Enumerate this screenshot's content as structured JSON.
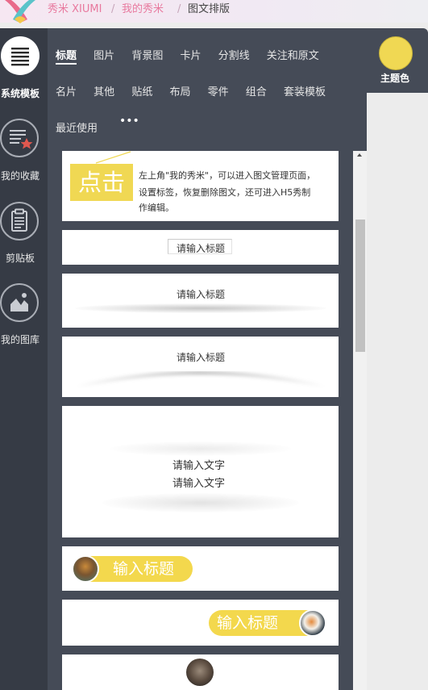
{
  "header": {
    "brand": "秀米 XIUMI",
    "crumb_my_xiumi": "我的秀米",
    "crumb_current": "图文排版",
    "separator": "/"
  },
  "sidebar": {
    "items": [
      {
        "label": "系统模板",
        "icon": "list-icon",
        "active": true
      },
      {
        "label": "我的收藏",
        "icon": "favorites-icon"
      },
      {
        "label": "剪贴板",
        "icon": "clipboard-icon"
      },
      {
        "label": "我的图库",
        "icon": "gallery-icon"
      }
    ]
  },
  "tabs": {
    "row1": [
      "标题",
      "图片",
      "背景图",
      "卡片",
      "分割线",
      "关注和原文"
    ],
    "row2": [
      "名片",
      "其他",
      "贴纸",
      "布局",
      "零件",
      "组合",
      "套装模板"
    ],
    "row3": [
      "最近使用"
    ],
    "more": "•••",
    "active": "标题"
  },
  "theme": {
    "label": "主题色",
    "color": "#f0d853"
  },
  "templates": {
    "tip_badge": "点击",
    "tip_text_1": "左上角\"我的秀米\"，可以进入图文管理页面，",
    "tip_text_2": "设置标签，恢复删除图文，还可进入H5秀制",
    "tip_text_3": "作编辑。",
    "title_placeholder": "请输入标题",
    "text_placeholder": "请输入文字",
    "pill_title": "输入标题"
  },
  "colors": {
    "accent_pink": "#e8799e",
    "sidebar_bg": "#363b45",
    "panel_bg": "#454b57",
    "theme_yellow": "#f0d853"
  }
}
